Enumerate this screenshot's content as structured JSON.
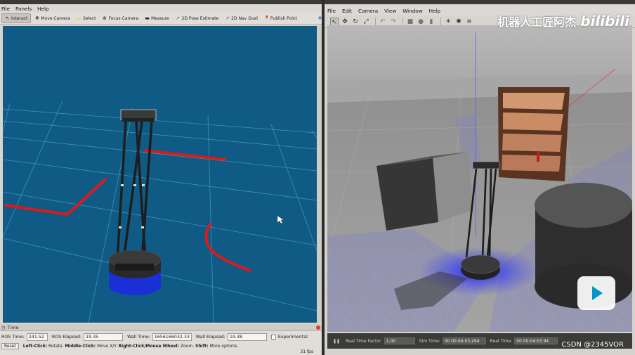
{
  "rviz": {
    "title": "",
    "menu": [
      "File",
      "Panels",
      "Help"
    ],
    "tools": [
      {
        "label": "Interact",
        "icon": "pointer-icon",
        "glyph": "↖",
        "active": true
      },
      {
        "label": "Move Camera",
        "icon": "move-camera-icon",
        "glyph": "✥",
        "active": false
      },
      {
        "label": "Select",
        "icon": "select-icon",
        "glyph": "▭",
        "active": false
      },
      {
        "label": "Focus Camera",
        "icon": "focus-camera-icon",
        "glyph": "⊕",
        "active": false
      },
      {
        "label": "Measure",
        "icon": "measure-icon",
        "glyph": "▬",
        "active": false
      },
      {
        "label": "2D Pose Estimate",
        "icon": "pose-estimate-icon",
        "glyph": "↗",
        "active": false
      },
      {
        "label": "2D Nav Goal",
        "icon": "nav-goal-icon",
        "glyph": "↗",
        "active": false
      },
      {
        "label": "Publish Point",
        "icon": "publish-point-icon",
        "glyph": "📍",
        "active": false
      },
      {
        "label": "",
        "icon": "add-tool-icon",
        "glyph": "✚",
        "active": false
      }
    ],
    "time_panel": {
      "title": "Time",
      "ros_time_label": "ROS Time:",
      "ros_time": "241.52",
      "ros_elapsed_label": "ROS Elapsed:",
      "ros_elapsed": "19.35",
      "wall_time_label": "Wall Time:",
      "wall_time": "1656166032.33",
      "wall_elapsed_label": "Wall Elapsed:",
      "wall_elapsed": "19.38",
      "experimental_label": "Experimental"
    },
    "status": {
      "reset_label": "Reset",
      "left_click": "Left-Click:",
      "left_action": "Rotate.",
      "middle_click": "Middle-Click:",
      "middle_action": "Move X/Y.",
      "right_click": "Right-Click/Mouse Wheel:",
      "right_action": "Zoom.",
      "shift": "Shift:",
      "shift_action": "More options.",
      "fps": "31 fps"
    },
    "colors": {
      "background": "#0f5b85",
      "grid": "#4aa0c7",
      "laser": "#e01818",
      "base": "#1a2fd6"
    }
  },
  "gazebo": {
    "menu": [
      "File",
      "Edit",
      "Camera",
      "View",
      "Window",
      "Help"
    ],
    "toolbar": [
      {
        "icon": "select-arrow-icon",
        "glyph": "↖",
        "active": true
      },
      {
        "icon": "translate-icon",
        "glyph": "✥"
      },
      {
        "icon": "rotate-icon",
        "glyph": "↻"
      },
      {
        "icon": "scale-icon",
        "glyph": "⤢"
      },
      {
        "icon": "undo-icon",
        "glyph": "↶"
      },
      {
        "icon": "redo-icon",
        "glyph": "↷"
      },
      {
        "icon": "box-icon",
        "glyph": "■"
      },
      {
        "icon": "sphere-icon",
        "glyph": "●"
      },
      {
        "icon": "cylinder-icon",
        "glyph": "▮"
      },
      {
        "icon": "sun-light-icon",
        "glyph": "☀"
      },
      {
        "icon": "point-light-icon",
        "glyph": "✺"
      },
      {
        "icon": "spot-light-icon",
        "glyph": "≋"
      }
    ],
    "bottom": {
      "rtf_label": "Real Time Factor:",
      "rtf": "1.00",
      "sim_label": "Sim Time:",
      "sim": "00 00:04:03.294",
      "real_label": "Real Time:",
      "real": "00 00:04:03.94"
    }
  },
  "overlay": {
    "watermark_text": "机器人工匠阿杰",
    "bilibili": "bilibili",
    "csdn": "CSDN @2345VOR"
  }
}
